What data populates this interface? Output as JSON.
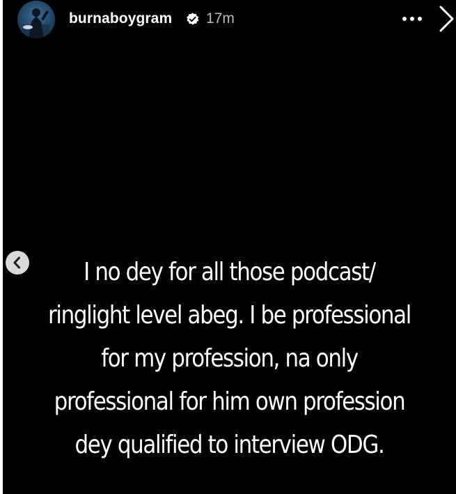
{
  "story": {
    "username": "burnaboygram",
    "time_ago": "17m",
    "verified": true,
    "caption_lines": [
      "I no dey for all those podcast/",
      "ringlight level abeg. I be professional",
      "for my profession, na only",
      "professional for him own profession",
      "dey qualified to interview ODG."
    ],
    "icons": {
      "avatar": "profile-avatar",
      "verified": "verified-badge-icon",
      "more": "more-options-icon",
      "next": "chevron-right-icon",
      "previous": "chevron-left-icon"
    },
    "colors": {
      "background": "#000000",
      "text": "#ffffff",
      "timestamp": "#bdbdbd",
      "prev_button": "#d9d9d9"
    }
  }
}
